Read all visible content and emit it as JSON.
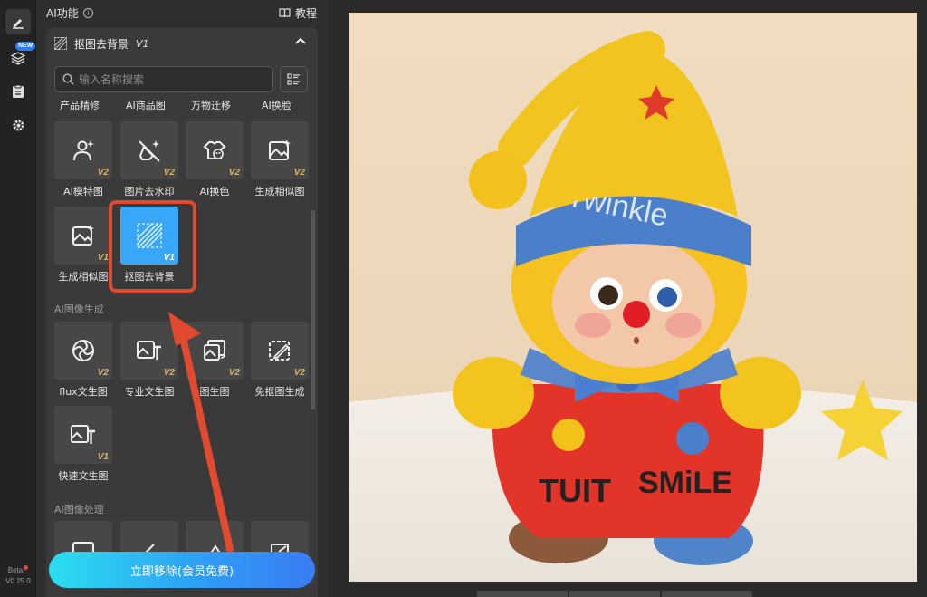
{
  "rail": {
    "new_badge": "NEW",
    "version_beta": "Beta",
    "version_number": "V0.25.0"
  },
  "panel": {
    "ai_header": "AI功能",
    "tutorial": "教程",
    "section_title": "抠图去背景",
    "section_version": "V1",
    "search_placeholder": "输入名称搜索",
    "top_row_labels": [
      "产品精修",
      "AI商品图",
      "万物迁移",
      "AI换脸"
    ],
    "tools_row1": [
      {
        "label": "AI模特图",
        "version": "V2",
        "icon": "person-sparkle-icon"
      },
      {
        "label": "图片去水印",
        "version": "V2",
        "icon": "erase-sparkle-icon"
      },
      {
        "label": "AI换色",
        "version": "V2",
        "icon": "shirt-palette-icon"
      },
      {
        "label": "生成相似图",
        "version": "V2",
        "icon": "image-sparkle-icon"
      }
    ],
    "tools_row2": [
      {
        "label": "生成相似图",
        "version": "V1",
        "icon": "image-sparkle-icon"
      },
      {
        "label": "抠图去背景",
        "version": "V1",
        "icon": "hatch-icon"
      }
    ],
    "category_generation": "AI图像生成",
    "tools_row3": [
      {
        "label": "flux文生图",
        "version": "V2",
        "icon": "aperture-icon"
      },
      {
        "label": "专业文生图",
        "version": "V2",
        "icon": "image-text-icon"
      },
      {
        "label": "图生图",
        "version": "V2",
        "icon": "image-swap-icon"
      },
      {
        "label": "免抠图生成",
        "version": "V2",
        "icon": "image-edit-icon"
      }
    ],
    "tools_row4": [
      {
        "label": "快速文生图",
        "version": "V1",
        "icon": "image-text-icon"
      }
    ],
    "category_processing": "AI图像处理",
    "primary_button": "立即移除(会员免费)"
  },
  "canvas": {
    "photo_hat_text": "Twinkle",
    "photo_shirt_text_left": "TUIT",
    "photo_shirt_text_right": "SMiLE"
  },
  "colors": {
    "accent": "#39a7f7",
    "highlight": "#e14a2f",
    "version_tag": "#d7b26a"
  }
}
